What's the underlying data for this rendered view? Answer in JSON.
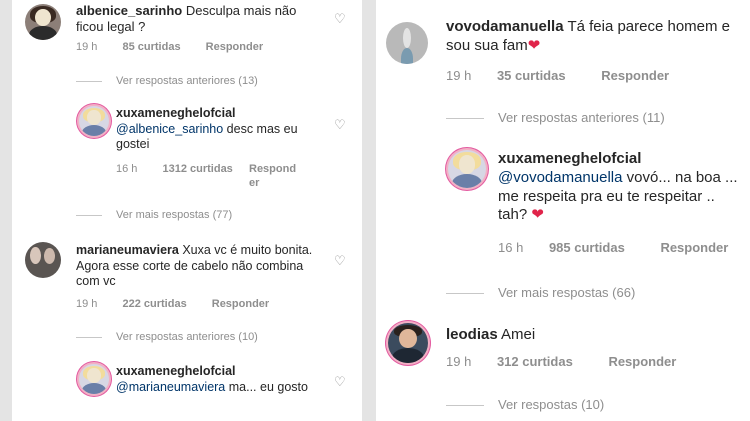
{
  "left": {
    "c1": {
      "user": "albenice_sarinho",
      "text": " Desculpa mais não ficou legal ?",
      "time": "19 h",
      "likes": "85 curtidas",
      "reply": "Responder"
    },
    "t1": "Ver respostas anteriores (13)",
    "r1": {
      "user": "xuxameneghelofcial",
      "mention": "@albenice_sarinho",
      "text": " desc mas eu gostei",
      "time": "16 h",
      "likes": "1312 curtidas",
      "reply_line1": "Respond",
      "reply_line2": "er"
    },
    "t2": "Ver mais respostas (77)",
    "c2": {
      "user": "marianeumaviera",
      "text": " Xuxa vc é muito bonita. Agora esse corte de cabelo não combina com vc",
      "time": "19 h",
      "likes": "222 curtidas",
      "reply": "Responder"
    },
    "t3": "Ver respostas anteriores (10)",
    "r2": {
      "user": "xuxameneghelofcial",
      "mention": "@marianeumaviera",
      "text": " ma... eu gosto"
    }
  },
  "right": {
    "c1": {
      "user": "vovodamanuella",
      "text": " Tá feia parece homem e sou sua fam",
      "heart": "❤",
      "time": "19 h",
      "likes": "35 curtidas",
      "reply": "Responder"
    },
    "t1": "Ver respostas anteriores (11)",
    "r1": {
      "user": "xuxameneghelofcial",
      "mention": "@vovodamanuella",
      "text": " vovó... na boa ... me respeita pra eu te respeitar .. tah? ",
      "heart": "❤",
      "time": "16 h",
      "likes": "985 curtidas",
      "reply": "Responder"
    },
    "t2": "Ver mais respostas (66)",
    "c2": {
      "user": "leodias",
      "text": " Amei",
      "time": "19 h",
      "likes": "312 curtidas",
      "reply": "Responder"
    },
    "t3": "Ver respostas (10)"
  },
  "icons": {
    "like": "heart-outline-icon",
    "heart_emoji": "red-heart-emoji"
  }
}
